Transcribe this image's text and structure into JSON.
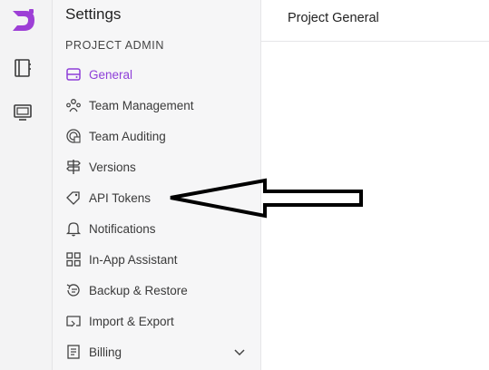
{
  "settings": {
    "title": "Settings",
    "section": "PROJECT ADMIN"
  },
  "nav": {
    "items": [
      {
        "label": "General",
        "icon": "database-icon",
        "active": true
      },
      {
        "label": "Team Management",
        "icon": "team-icon"
      },
      {
        "label": "Team Auditing",
        "icon": "audit-icon"
      },
      {
        "label": "Versions",
        "icon": "signpost-icon"
      },
      {
        "label": "API Tokens",
        "icon": "tag-icon"
      },
      {
        "label": "Notifications",
        "icon": "bell-icon"
      },
      {
        "label": "In-App Assistant",
        "icon": "grid-icon"
      },
      {
        "label": "Backup & Restore",
        "icon": "restore-icon"
      },
      {
        "label": "Import & Export",
        "icon": "import-export-icon"
      },
      {
        "label": "Billing",
        "icon": "receipt-icon"
      }
    ]
  },
  "main": {
    "title": "Project General"
  },
  "colors": {
    "accent": "#8e3fd8",
    "rail_bg": "#f3f3f4",
    "panel_bg": "#f6f6f7"
  }
}
